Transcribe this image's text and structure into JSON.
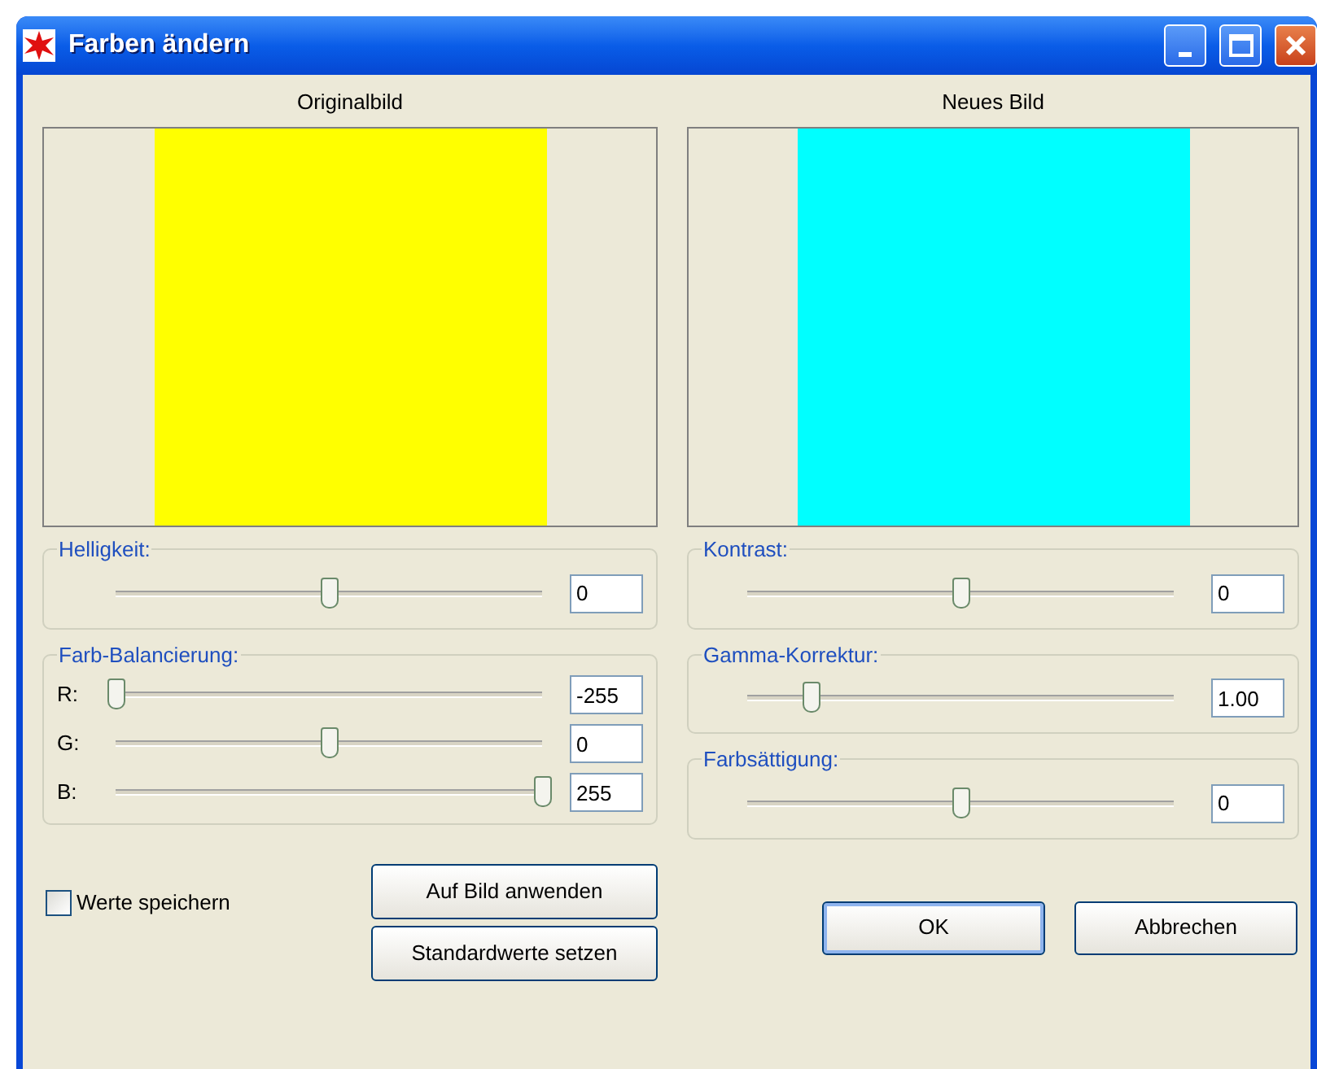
{
  "window": {
    "title": "Farben ändern"
  },
  "previews": [
    {
      "label": "Originalbild",
      "color": "#ffff00"
    },
    {
      "label": "Neues Bild",
      "color": "#00ffff"
    }
  ],
  "left_groups": [
    {
      "title": "Helligkeit:",
      "sliders": [
        {
          "level": 0.5,
          "value": "0"
        }
      ]
    },
    {
      "title": "Farb-Balancierung:",
      "sliders": [
        {
          "label": "R:",
          "level": 0,
          "value": "-255"
        },
        {
          "label": "G:",
          "level": 0.5,
          "value": "0"
        },
        {
          "label": "B:",
          "level": 1,
          "value": "255"
        }
      ]
    }
  ],
  "right_groups": [
    {
      "title": "Kontrast:",
      "sliders": [
        {
          "level": 0.5,
          "value": "0"
        }
      ]
    },
    {
      "title": "Gamma-Korrektur:",
      "sliders": [
        {
          "level": 0.15,
          "value": "1.00"
        }
      ]
    },
    {
      "title": "Farbsättigung:",
      "sliders": [
        {
          "level": 0.5,
          "value": "0"
        }
      ]
    }
  ],
  "save_values": {
    "label": "Werte speichern",
    "checked": false
  },
  "buttons_left": [
    "Auf Bild anwenden",
    "Standardwerte setzen"
  ],
  "buttons_right": [
    {
      "label": "OK",
      "default": true
    },
    {
      "label": "Abbrechen",
      "default": false
    }
  ]
}
